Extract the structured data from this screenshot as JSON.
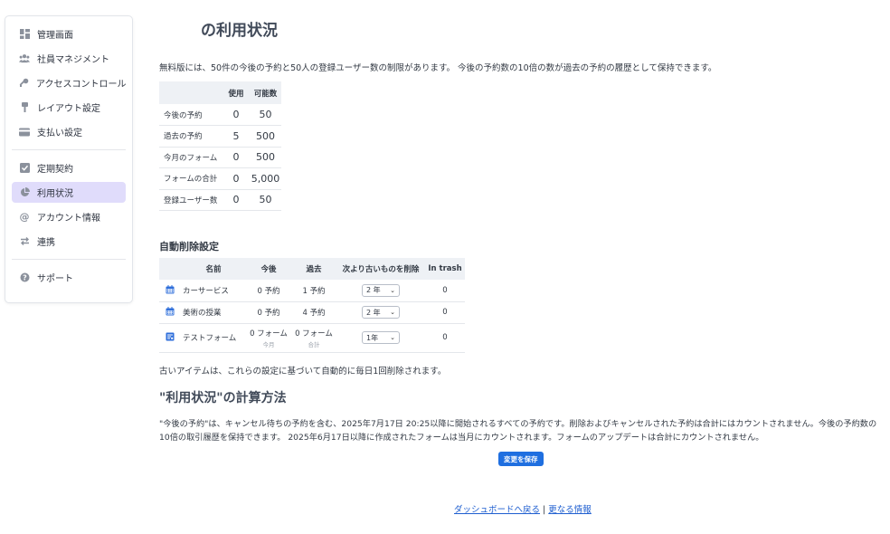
{
  "colors": {
    "accent": "#1f6fe0",
    "active_bg": "#e0dcfb",
    "table_header_bg": "#eef1f5",
    "icon_blue": "#2f6fdb"
  },
  "sidebar": {
    "items": [
      {
        "label": "管理画面",
        "icon": "dashboard-icon"
      },
      {
        "label": "社員マネジメント",
        "icon": "users-icon"
      },
      {
        "label": "アクセスコントロール",
        "icon": "key-icon"
      },
      {
        "label": "レイアウト設定",
        "icon": "brush-icon"
      },
      {
        "label": "支払い設定",
        "icon": "credit-card-icon"
      },
      {
        "label": "定期契約",
        "icon": "check-square-icon"
      },
      {
        "label": "利用状況",
        "icon": "pie-chart-icon",
        "active": true
      },
      {
        "label": "アカウント情報",
        "icon": "at-icon"
      },
      {
        "label": "連携",
        "icon": "arrows-swap-icon"
      },
      {
        "label": "サポート",
        "icon": "help-icon"
      }
    ]
  },
  "main": {
    "title": "の利用状況",
    "intro": "無料版には、50件の今後の予約と50人の登録ユーザー数の制限があります。 今後の予約数の10倍の数が過去の予約の履歴として保持できます。",
    "usage_table": {
      "headers": [
        "",
        "使用",
        "可能数"
      ],
      "rows": [
        {
          "label": "今後の予約",
          "used": "0",
          "limit": "50"
        },
        {
          "label": "過去の予約",
          "used": "5",
          "limit": "500"
        },
        {
          "label": "今月のフォーム",
          "used": "0",
          "limit": "500"
        },
        {
          "label": "フォームの合計",
          "used": "0",
          "limit": "5,000"
        },
        {
          "label": "登録ユーザー数",
          "used": "0",
          "limit": "50"
        }
      ]
    },
    "auto_delete": {
      "title": "自動削除設定",
      "headers": [
        "",
        "名前",
        "今後",
        "過去",
        "次より古いものを削除",
        "In trash"
      ],
      "rows": [
        {
          "icon": "calendar-icon",
          "name": "カーサービス",
          "future": "0 予約",
          "future_sub": "",
          "past": "1 予約",
          "past_sub": "",
          "delete_after": "2 年",
          "trash": "0"
        },
        {
          "icon": "calendar-icon",
          "name": "美術の授業",
          "future": "0 予約",
          "future_sub": "",
          "past": "4 予約",
          "past_sub": "",
          "delete_after": "2 年",
          "trash": "0"
        },
        {
          "icon": "form-icon",
          "name": "テストフォーム",
          "future": "0 フォーム",
          "future_sub": "今月",
          "past": "0 フォーム",
          "past_sub": "合計",
          "delete_after": "1年",
          "trash": "0"
        }
      ]
    },
    "auto_delete_note": "古いアイテムは、これらの設定に基づいて自動的に毎日1回削除されます。",
    "calc": {
      "title": "\"利用状況\"の計算方法",
      "text": "\"今後の予約\"は、キャンセル待ちの予約を含む、2025年7月17日 20:25以降に開始されるすべての予約です。削除およびキャンセルされた予約は合計にはカウントされません。今後の予約数の10倍の取引履歴を保持できます。 2025年6月17日以降に作成されたフォームは当月にカウントされます。フォームのアップデートは合計にカウントされません。"
    },
    "save_label": "変更を保存",
    "footer": {
      "link1": "ダッシュボードへ戻る",
      "separator": "|",
      "link2": "更なる情報"
    }
  }
}
